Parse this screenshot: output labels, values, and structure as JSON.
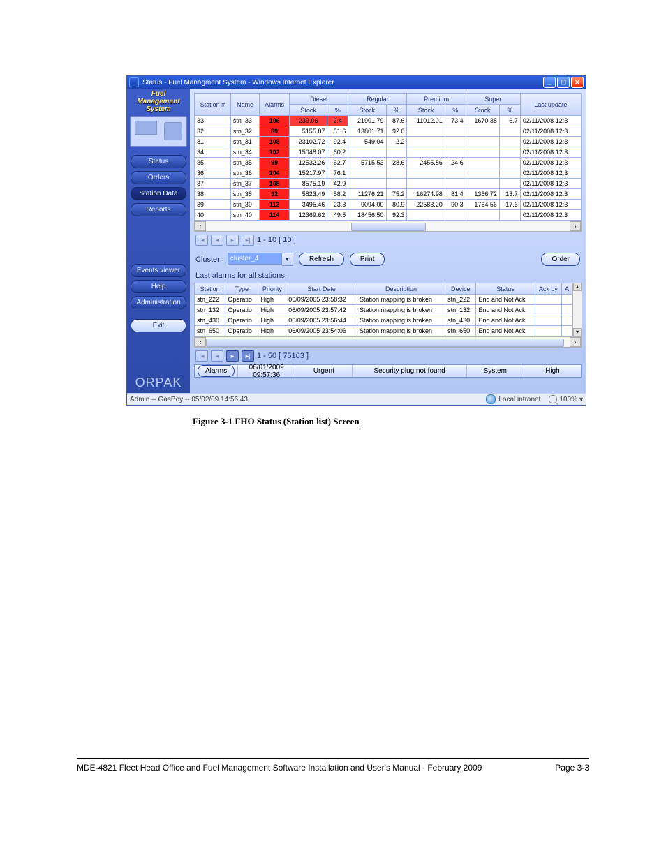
{
  "window": {
    "title": "Status - Fuel Managment System - Windows Internet Explorer"
  },
  "brand": {
    "line1": "Fuel",
    "line2": "Management",
    "line3": "System"
  },
  "nav": {
    "status": "Status",
    "orders": "Orders",
    "station_data": "Station Data",
    "reports": "Reports",
    "events_viewer": "Events viewer",
    "help": "Help",
    "administration": "Administration",
    "exit": "Exit"
  },
  "logo": "ORPAK",
  "fuel_table": {
    "headers": {
      "station_no": "Station #",
      "name": "Name",
      "alarms": "Alarms",
      "diesel": "Diesel",
      "regular": "Regular",
      "premium": "Premium",
      "super": "Super",
      "stock": "Stock",
      "pct": "%",
      "last_update": "Last update"
    },
    "rows": [
      {
        "station": "33",
        "name": "stn_33",
        "alarms": "106",
        "alarms_red": true,
        "d_stock": "239.06",
        "d_pct": "2.4",
        "d_warn": true,
        "r_stock": "21901.79",
        "r_pct": "87.6",
        "p_stock": "11012.01",
        "p_pct": "73.4",
        "s_stock": "1670.38",
        "s_pct": "6.7",
        "last": "02/11/2008 12:3"
      },
      {
        "station": "32",
        "name": "stn_32",
        "alarms": "89",
        "alarms_red": true,
        "d_stock": "5155.87",
        "d_pct": "51.6",
        "r_stock": "13801.71",
        "r_pct": "92.0",
        "p_stock": "",
        "p_pct": "",
        "s_stock": "",
        "s_pct": "",
        "last": "02/11/2008 12:3"
      },
      {
        "station": "31",
        "name": "stn_31",
        "alarms": "108",
        "alarms_red": true,
        "d_stock": "23102.72",
        "d_pct": "92.4",
        "r_stock": "549.04",
        "r_pct": "2.2",
        "p_stock": "",
        "p_pct": "",
        "s_stock": "",
        "s_pct": "",
        "last": "02/11/2008 12:3"
      },
      {
        "station": "34",
        "name": "stn_34",
        "alarms": "102",
        "alarms_red": true,
        "d_stock": "15048.07",
        "d_pct": "60.2",
        "r_stock": "",
        "r_pct": "",
        "p_stock": "",
        "p_pct": "",
        "s_stock": "",
        "s_pct": "",
        "last": "02/11/2008 12:3"
      },
      {
        "station": "35",
        "name": "stn_35",
        "alarms": "99",
        "alarms_red": true,
        "d_stock": "12532.26",
        "d_pct": "62.7",
        "r_stock": "5715.53",
        "r_pct": "28.6",
        "p_stock": "2455.86",
        "p_pct": "24.6",
        "s_stock": "",
        "s_pct": "",
        "last": "02/11/2008 12:3"
      },
      {
        "station": "36",
        "name": "stn_36",
        "alarms": "104",
        "alarms_red": true,
        "d_stock": "15217.97",
        "d_pct": "76.1",
        "r_stock": "",
        "r_pct": "",
        "p_stock": "",
        "p_pct": "",
        "s_stock": "",
        "s_pct": "",
        "last": "02/11/2008 12:3"
      },
      {
        "station": "37",
        "name": "stn_37",
        "alarms": "108",
        "alarms_red": true,
        "d_stock": "8575.19",
        "d_pct": "42.9",
        "r_stock": "",
        "r_pct": "",
        "p_stock": "",
        "p_pct": "",
        "s_stock": "",
        "s_pct": "",
        "last": "02/11/2008 12:3"
      },
      {
        "station": "38",
        "name": "stn_38",
        "alarms": "92",
        "alarms_red": true,
        "d_stock": "5823.49",
        "d_pct": "58.2",
        "r_stock": "11276.21",
        "r_pct": "75.2",
        "p_stock": "16274.98",
        "p_pct": "81.4",
        "s_stock": "1366.72",
        "s_pct": "13.7",
        "last": "02/11/2008 12:3"
      },
      {
        "station": "39",
        "name": "stn_39",
        "alarms": "113",
        "alarms_red": true,
        "d_stock": "3495.46",
        "d_pct": "23.3",
        "r_stock": "9094.00",
        "r_pct": "80.9",
        "p_stock": "22583.20",
        "p_pct": "90.3",
        "s_stock": "1764.56",
        "s_pct": "17.6",
        "last": "02/11/2008 12:3"
      },
      {
        "station": "40",
        "name": "stn_40",
        "alarms": "114",
        "alarms_red": true,
        "d_stock": "12369.62",
        "d_pct": "49.5",
        "r_stock": "18456.50",
        "r_pct": "92.3",
        "p_stock": "",
        "p_pct": "",
        "s_stock": "",
        "s_pct": "",
        "last": "02/11/2008 12:3"
      }
    ],
    "pager": "1 - 10  [ 10 ]"
  },
  "cluster": {
    "label": "Cluster:",
    "value": "cluster_4",
    "refresh": "Refresh",
    "print": "Print",
    "order": "Order"
  },
  "alarms_label": "Last alarms for all stations:",
  "alarms_table": {
    "headers": {
      "station": "Station",
      "type": "Type",
      "priority": "Priority",
      "start_date": "Start Date",
      "description": "Description",
      "device": "Device",
      "status": "Status",
      "ack_by": "Ack by",
      "a": "A"
    },
    "rows": [
      {
        "station": "stn_222",
        "type": "Operatio",
        "priority": "High",
        "start": "06/09/2005 23:58:32",
        "desc": "Station mapping is broken",
        "device": "stn_222",
        "status": "End and Not Ack",
        "ack": ""
      },
      {
        "station": "stn_132",
        "type": "Operatio",
        "priority": "High",
        "start": "06/09/2005 23:57:42",
        "desc": "Station mapping is broken",
        "device": "stn_132",
        "status": "End and Not Ack",
        "ack": ""
      },
      {
        "station": "stn_430",
        "type": "Operatio",
        "priority": "High",
        "start": "06/09/2005 23:56:44",
        "desc": "Station mapping is broken",
        "device": "stn_430",
        "status": "End and Not Ack",
        "ack": ""
      },
      {
        "station": "stn_650",
        "type": "Operatio",
        "priority": "High",
        "start": "06/09/2005 23:54:06",
        "desc": "Station mapping is broken",
        "device": "stn_650",
        "status": "End and Not Ack",
        "ack": ""
      }
    ],
    "pager": "1 - 50  [ 75163 ]"
  },
  "statusbar": {
    "alarms_btn": "Alarms",
    "datetime": "06/01/2009 09:57:36",
    "priority": "Urgent",
    "message": "Security plug not found",
    "source": "System",
    "level": "High"
  },
  "ie_status": {
    "left": "Admin -- GasBoy -- 05/02/09 14:56:43",
    "zone": "Local intranet",
    "zoom": "100%"
  },
  "caption": "Figure 3-1 FHO Status (Station list) Screen",
  "doc_footer": {
    "left": "MDE-4821 Fleet Head Office and Fuel Management Software Installation and User's Manual · February 2009",
    "right": "Page 3-3"
  }
}
